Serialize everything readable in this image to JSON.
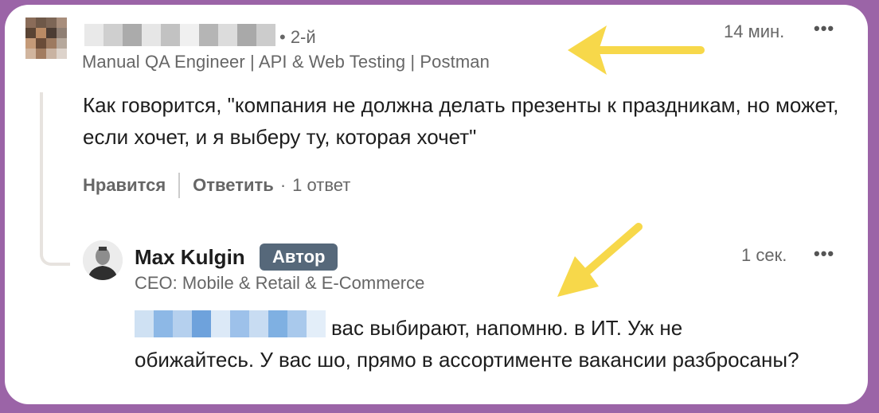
{
  "comment": {
    "degree": "• 2-й",
    "headline": "Manual QA Engineer | API & Web Testing | Postman",
    "time": "14 мин.",
    "menu": "•••",
    "text": "Как говорится, \"компания не должна делать презенты к праздникам, но может, если хочет, и я выберу ту, которая хочет\"",
    "actions": {
      "like": "Нравится",
      "reply": "Ответить",
      "separator": "·",
      "replies": "1 ответ"
    }
  },
  "reply": {
    "author": "Max Kulgin",
    "badge": "Автор",
    "headline": "CEO: Mobile & Retail & E-Commerce",
    "time": "1 сек.",
    "menu": "•••",
    "text_line1": "вас выбирают, напомню. в ИТ. Уж не",
    "text_rest": "обижайтесь. У вас шо, прямо в ассортименте вакансии разбросаны?"
  },
  "colors": {
    "frame": "#9b64a7",
    "arrow": "#f7d84a",
    "badge": "#56687a"
  },
  "icons": [
    "commenter-avatar-blurred",
    "author-avatar",
    "more-options-icon",
    "arrow-annotation"
  ]
}
